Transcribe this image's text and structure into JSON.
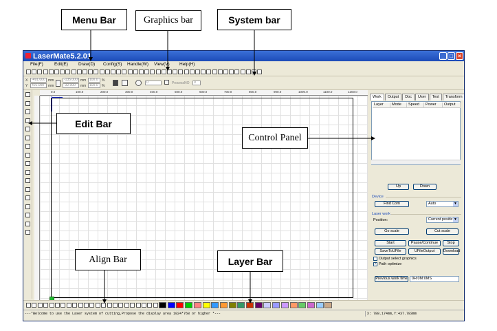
{
  "callouts": {
    "menu_bar": "Menu Bar",
    "graphics_bar": "Graphics bar",
    "system_bar": "System bar",
    "edit_bar": "Edit Bar",
    "control_panel": "Control Panel",
    "align_bar": "Align Bar",
    "layer_bar": "Layer Bar"
  },
  "window": {
    "title": "LaserMate5.2.01",
    "buttons": {
      "minimize": "_",
      "maximize": "□",
      "close": "×"
    }
  },
  "menu": {
    "items": [
      "File(F)",
      "Edit(E)",
      "Draw(D)",
      "Config(S)",
      "Handle(W)",
      "View(V)",
      "Help(H)"
    ]
  },
  "toolbar2": {
    "x_label": "X",
    "y_label": "Y",
    "x_value": "-491.000",
    "y_value": "401.000",
    "unit_mm": "mm",
    "w_value": "-135.000",
    "h_value": "-32.000",
    "pct1": "100.0",
    "pct2": "100.0",
    "percent": "%",
    "rotate_value": "0",
    "process_label": "ProcessNO",
    "process_value": "0"
  },
  "ruler": {
    "ticks": [
      "0.0",
      "100.0",
      "200.0",
      "300.0",
      "400.0",
      "500.0",
      "600.0",
      "700.0",
      "800.0",
      "900.0",
      "1000.0",
      "1100.0",
      "1200.0"
    ]
  },
  "control_panel": {
    "tabs": [
      "Work",
      "Output",
      "Doc",
      "User",
      "Test",
      "Transform"
    ],
    "active_tab": "Work",
    "layer_columns": [
      "Layer",
      "Mode",
      "Speed",
      "Power",
      "Output"
    ],
    "up_button": "Up",
    "down_button": "Down",
    "device_group": "Device",
    "find_com_button": "Find Com",
    "device_select": "Auto",
    "laser_work_group": "Laser work",
    "position_label": "Position:",
    "position_select": "Current positic",
    "go_scale_button": "Go scale",
    "cut_scale_button": "Cut scale",
    "start_button": "Start",
    "pause_button": "Pause/Continue",
    "stop_button": "Stop",
    "save_button": "SaveToUFile",
    "ufile_button": "UFileOutput",
    "download_button": "Download",
    "output_select_label": "Output select graphics",
    "path_optimize_label": "Path optimize",
    "path_optimize_checked": "✓",
    "prev_time_label": "Previous work time",
    "prev_time_value": "0H:0M:0MS"
  },
  "layer_colors": [
    "#000000",
    "#0000ff",
    "#ff0000",
    "#00cc00",
    "#ff8080",
    "#ffff00",
    "#3399ff",
    "#ff9933",
    "#808000",
    "#339966",
    "#cc3300",
    "#660066",
    "#ccccff",
    "#9999ff",
    "#cc99ff",
    "#ff9966",
    "#66cc66",
    "#cc66cc",
    "#99ccff",
    "#ccaa88"
  ],
  "status": {
    "message": "---*Welcome to use the Laser system of cutting,Propose the display area 1024*768 or higher *---",
    "coords": "X: 788.174mm,Y:437.783mm"
  }
}
